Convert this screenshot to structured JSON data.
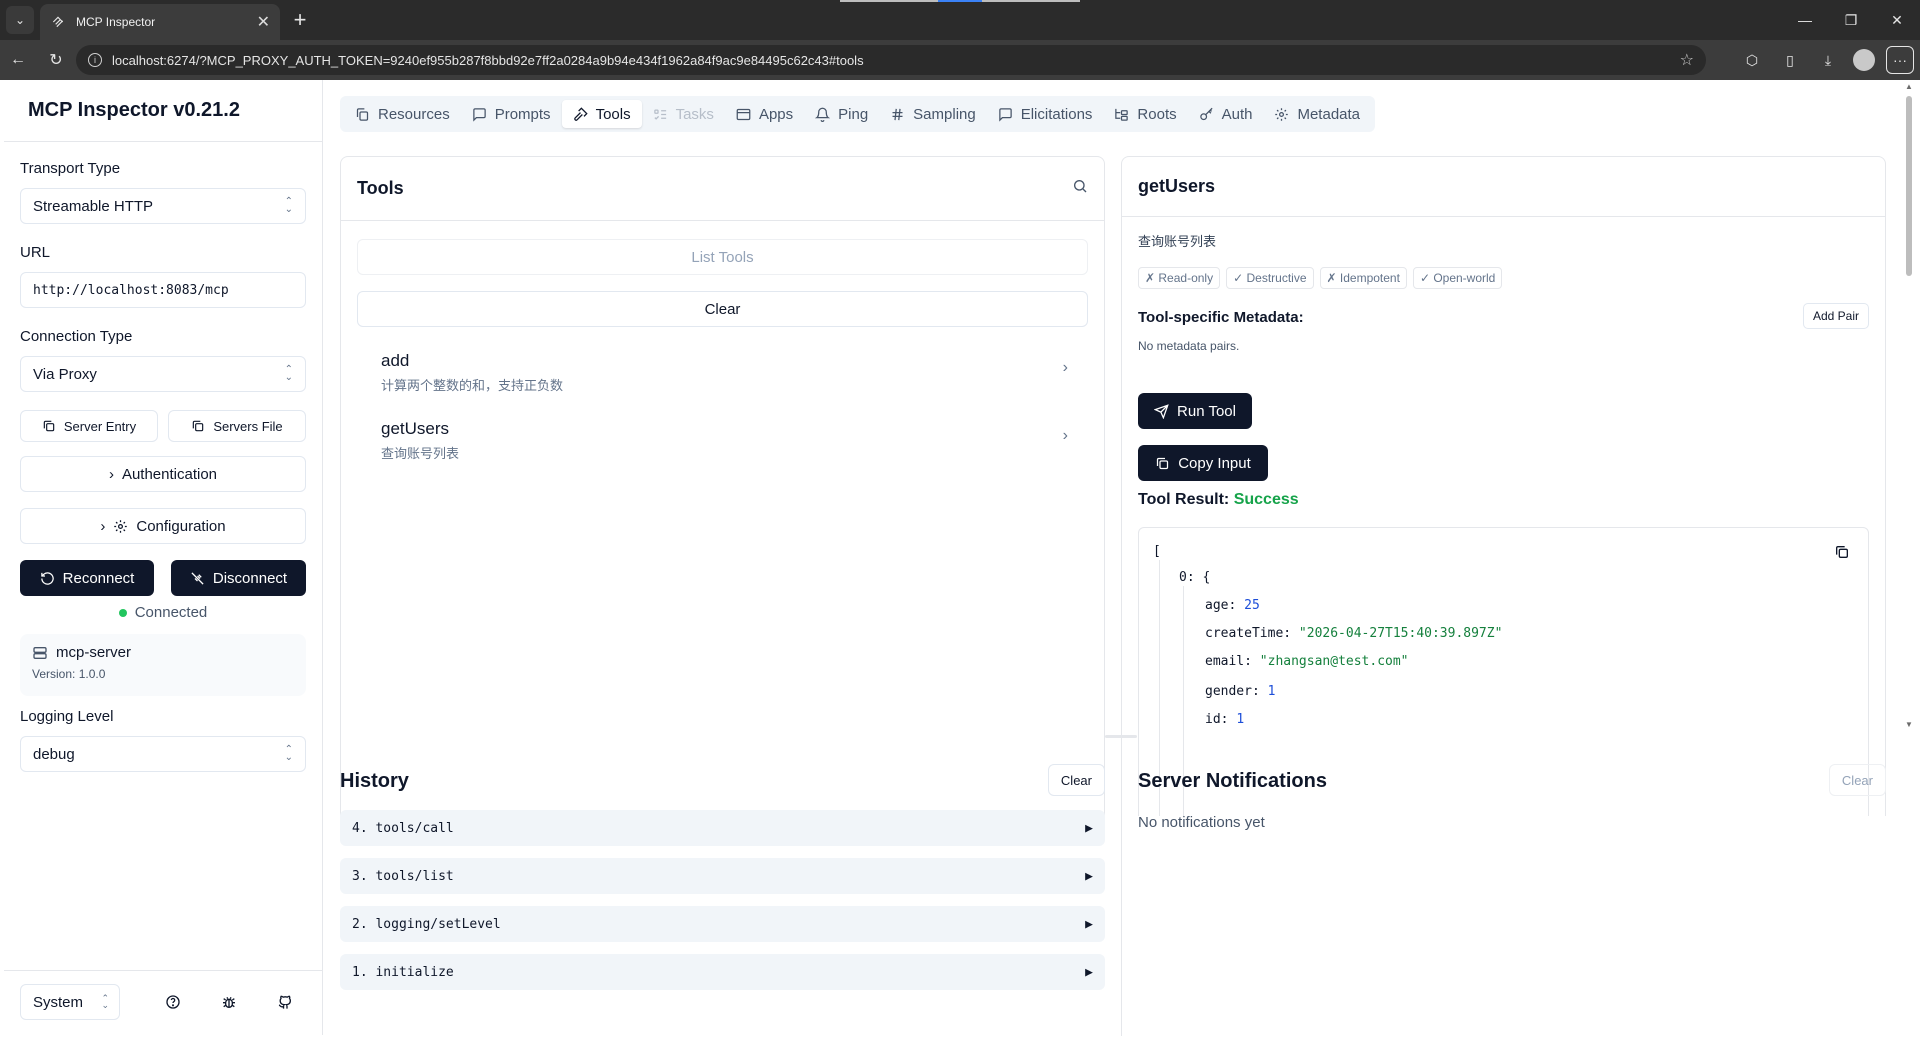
{
  "browser": {
    "tab_title": "MCP Inspector",
    "url": "localhost:6274/?MCP_PROXY_AUTH_TOKEN=9240ef955b287f8bbd92e7ff2a0284a9b94e434f1962a84f9ac9e84495c62c43#tools"
  },
  "sidebar": {
    "title": "MCP Inspector v0.21.2",
    "transport_label": "Transport Type",
    "transport_value": "Streamable HTTP",
    "url_label": "URL",
    "url_value": "http://localhost:8083/mcp",
    "connection_label": "Connection Type",
    "connection_value": "Via Proxy",
    "server_entry_label": "Server Entry",
    "servers_file_label": "Servers File",
    "authentication_label": "Authentication",
    "configuration_label": "Configuration",
    "reconnect_label": "Reconnect",
    "disconnect_label": "Disconnect",
    "status_text": "Connected",
    "server_name": "mcp-server",
    "server_version": "Version: 1.0.0",
    "logging_label": "Logging Level",
    "logging_value": "debug",
    "theme_value": "System"
  },
  "tabs": [
    {
      "label": "Resources",
      "icon": "files-icon",
      "state": "normal"
    },
    {
      "label": "Prompts",
      "icon": "message-square-icon",
      "state": "normal"
    },
    {
      "label": "Tools",
      "icon": "hammer-icon",
      "state": "active"
    },
    {
      "label": "Tasks",
      "icon": "list-todo-icon",
      "state": "disabled"
    },
    {
      "label": "Apps",
      "icon": "app-window-icon",
      "state": "normal"
    },
    {
      "label": "Ping",
      "icon": "bell-icon",
      "state": "normal"
    },
    {
      "label": "Sampling",
      "icon": "hash-icon",
      "state": "normal"
    },
    {
      "label": "Elicitations",
      "icon": "message-square-icon",
      "state": "normal"
    },
    {
      "label": "Roots",
      "icon": "folder-tree-icon",
      "state": "normal"
    },
    {
      "label": "Auth",
      "icon": "key-icon",
      "state": "normal"
    },
    {
      "label": "Metadata",
      "icon": "gear-icon",
      "state": "normal"
    }
  ],
  "tools_panel": {
    "title": "Tools",
    "list_tools_label": "List Tools",
    "clear_label": "Clear",
    "tools": [
      {
        "name": "add",
        "description": "计算两个整数的和，支持正负数"
      },
      {
        "name": "getUsers",
        "description": "查询账号列表"
      }
    ]
  },
  "tool_detail": {
    "name": "getUsers",
    "description": "查询账号列表",
    "annotations": [
      "✗ Read-only",
      "✓ Destructive",
      "✗ Idempotent",
      "✓ Open-world"
    ],
    "metadata_title": "Tool-specific Metadata:",
    "add_pair_label": "Add Pair",
    "no_metadata": "No metadata pairs.",
    "run_tool_label": "Run Tool",
    "copy_input_label": "Copy Input",
    "result_label": "Tool Result:",
    "result_status": "Success",
    "result_json": {
      "open_bracket": "[",
      "index_key": "0:",
      "open_brace": "{",
      "fields": [
        {
          "key": "age:",
          "value": "25",
          "kind": "num"
        },
        {
          "key": "createTime:",
          "value": "\"2026-04-27T15:40:39.897Z\"",
          "kind": "str"
        },
        {
          "key": "email:",
          "value": "\"zhangsan@test.com\"",
          "kind": "str"
        },
        {
          "key": "gender:",
          "value": "1",
          "kind": "num"
        },
        {
          "key": "id:",
          "value": "1",
          "kind": "num"
        }
      ]
    }
  },
  "history": {
    "title": "History",
    "clear_label": "Clear",
    "items": [
      "4. tools/call",
      "3. tools/list",
      "2. logging/setLevel",
      "1. initialize"
    ]
  },
  "notifications": {
    "title": "Server Notifications",
    "clear_label": "Clear",
    "empty_text": "No notifications yet"
  },
  "colors": {
    "primary_dark": "#0f172a",
    "success": "#16a34a",
    "connected_dot": "#22c55e",
    "json_number": "#1d4ed8",
    "json_string": "#15803d"
  }
}
